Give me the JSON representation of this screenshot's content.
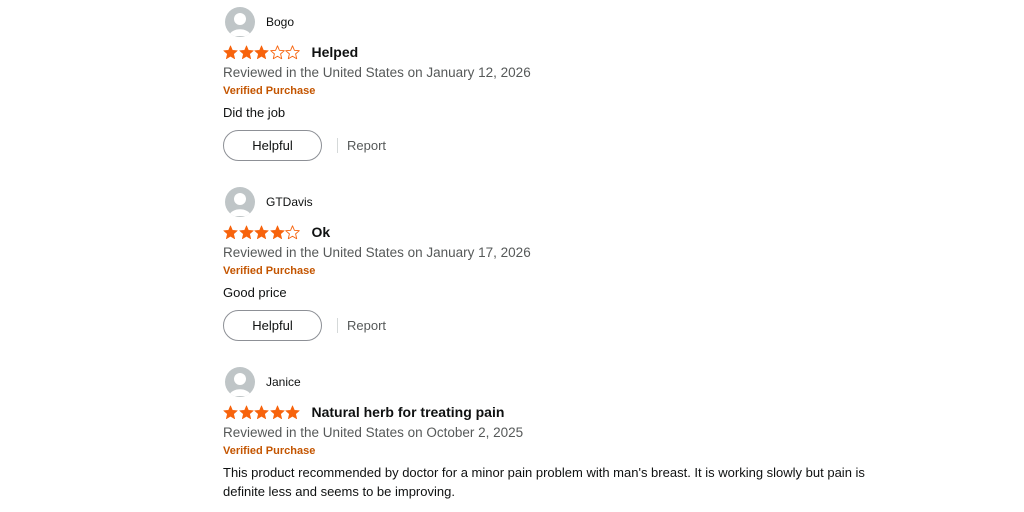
{
  "colors": {
    "star_filled": "#f7630c",
    "star_empty_outline": "#f7630c",
    "verified": "#c45500",
    "avatar_bg": "#bfc5c7",
    "meta_text": "#565959"
  },
  "icons": {
    "avatar": "default-user-avatar-icon",
    "star": "star-icon"
  },
  "reviews": [
    {
      "reviewer": "Bogo",
      "rating": 3,
      "title": "Helped",
      "date": "Reviewed in the United States on January 12, 2026",
      "verified": "Verified Purchase",
      "body": "Did the job",
      "helpful_label": "Helpful",
      "report_label": "Report"
    },
    {
      "reviewer": "GTDavis",
      "rating": 4,
      "title": "Ok",
      "date": "Reviewed in the United States on January 17, 2026",
      "verified": "Verified Purchase",
      "body": "Good price",
      "helpful_label": "Helpful",
      "report_label": "Report"
    },
    {
      "reviewer": "Janice",
      "rating": 5,
      "title": "Natural herb for treating pain",
      "date": "Reviewed in the United States on October 2, 2025",
      "verified": "Verified Purchase",
      "body": "This product recommended by doctor for a minor pain problem with man's breast. It is working slowly but pain is definite less and seems to be improving."
    }
  ]
}
